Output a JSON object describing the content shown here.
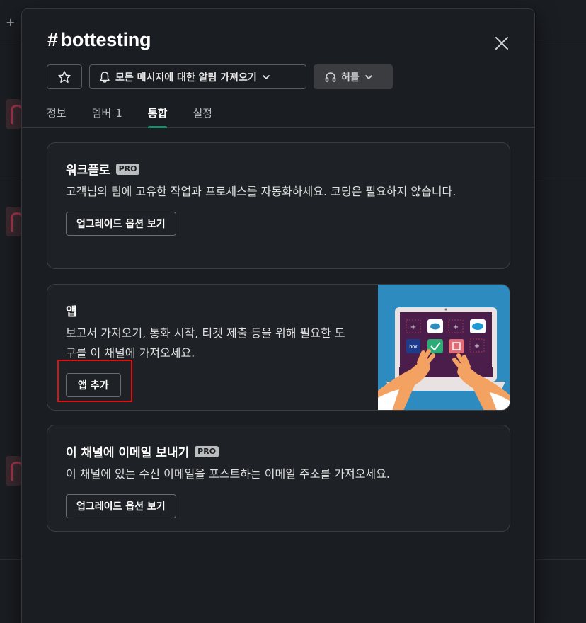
{
  "channel": {
    "hash": "#",
    "name": "bottesting"
  },
  "actions": {
    "star_icon": "star-icon",
    "notifications_label": "모든 메시지에 대한 알림 가져오기",
    "huddle_label": "허들"
  },
  "tabs": [
    {
      "label": "정보",
      "count": ""
    },
    {
      "label": "멤버",
      "count": "1"
    },
    {
      "label": "통합",
      "count": ""
    },
    {
      "label": "설정",
      "count": ""
    }
  ],
  "active_tab": "통합",
  "cards": {
    "workflow": {
      "title": "워크플로",
      "badge": "PRO",
      "description": "고객님의 팀에 고유한 작업과 프로세스를 자동화하세요. 코딩은 필요하지 않습니다.",
      "button": "업그레이드 옵션 보기"
    },
    "apps": {
      "title": "앱",
      "description": "보고서 가져오기, 통화 시작, 티켓 제출 등을 위해 필요한 도구를 이 채널에 가져오세요.",
      "button": "앱 추가",
      "illustration_label": "box"
    },
    "email": {
      "title": "이 채널에 이메일 보내기",
      "badge": "PRO",
      "description": "이 채널에 있는 수신 이메일을 포스트하는 이메일 주소를 가져오세요.",
      "button": "업그레이드 옵션 보기"
    }
  },
  "colors": {
    "accent_tab": "#1b8a6e",
    "highlight": "#e01010",
    "illustration_bg": "#2e8bc0"
  }
}
